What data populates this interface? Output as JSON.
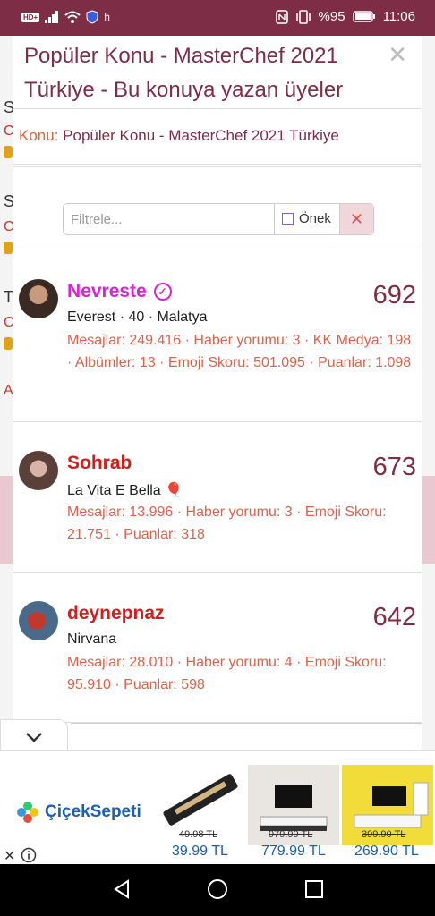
{
  "status_bar": {
    "left_badge": "HD+",
    "left_text": "h",
    "battery_percent": "%95",
    "time": "11:06"
  },
  "modal": {
    "title": "Popüler Konu - MasterChef 2021 Türkiye - Bu konuya yazan üyeler",
    "close_symbol": "✕",
    "konu_label": "Konu:",
    "konu_value": "Popüler Konu - MasterChef 2021 Türkiye",
    "filter": {
      "placeholder": "Filtrele...",
      "prefix_label": "Önek",
      "clear_symbol": "✕"
    },
    "users": [
      {
        "name": "Nevreste",
        "verified": true,
        "subtitle": "Everest · 40 · Malatya",
        "stats": "Mesajlar: 249.416 · Haber yorumu: 3 · KK Medya: 198 · Albümler: 13 · Emoji Skoru: 501.095 · Puanlar: 1.098",
        "count": "692"
      },
      {
        "name": "Sohrab",
        "verified": false,
        "subtitle": "La Vita E Bella 🎈",
        "stats": "Mesajlar: 13.996 · Haber yorumu: 3 · Emoji Skoru: 21.751 · Puanlar: 318",
        "count": "673"
      },
      {
        "name": "deynepnaz",
        "verified": false,
        "subtitle": "Nirvana",
        "stats": "Mesajlar: 28.010 · Haber yorumu: 4 · Emoji Skoru: 95.910 · Puanlar: 598",
        "count": "642"
      }
    ]
  },
  "ad": {
    "brand": "ÇiçekSepeti",
    "products": [
      {
        "old_price": "49.98 TL",
        "new_price": "39.99 TL"
      },
      {
        "old_price": "979.99 TL",
        "new_price": "779.99 TL"
      },
      {
        "old_price": "399.90 TL",
        "new_price": "269.90 TL"
      }
    ]
  },
  "colors": {
    "brand": "#7d2d45",
    "accent_orange": "#e0603a",
    "name_magenta": "#e020d8",
    "name_red": "#d81b1b"
  }
}
